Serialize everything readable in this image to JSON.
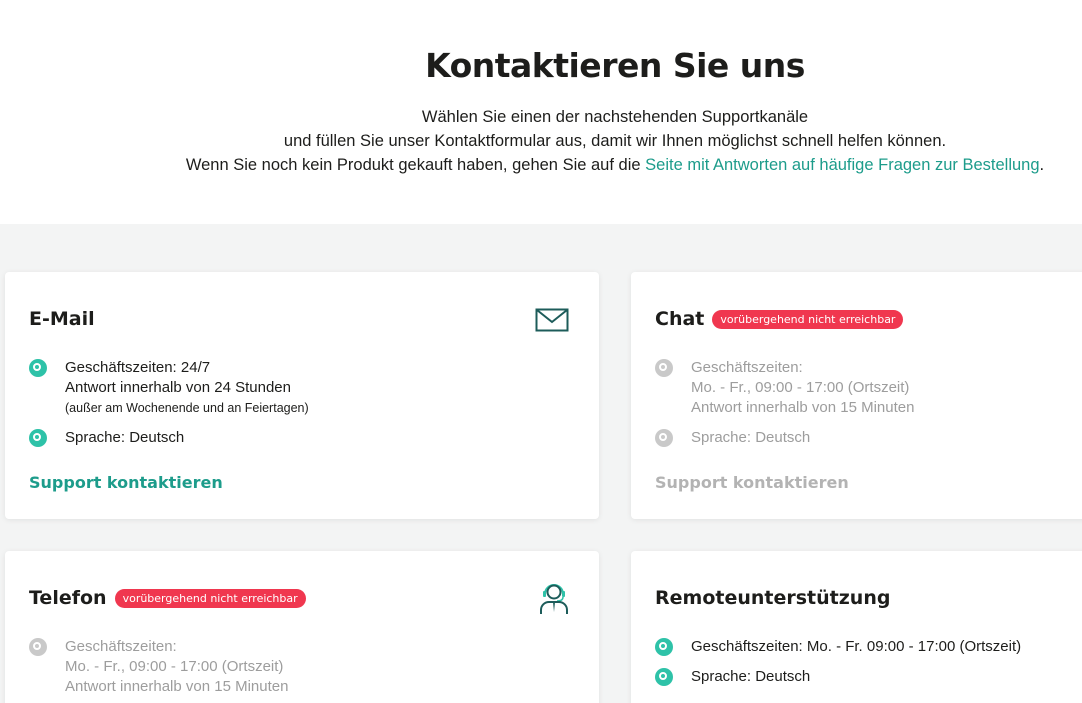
{
  "header": {
    "title": "Kontaktieren Sie uns",
    "line1": "Wählen Sie einen der nachstehenden Supportkanäle",
    "line2": "und füllen Sie unser Kontaktformular aus, damit wir Ihnen möglichst schnell helfen können.",
    "line3_prefix": "Wenn Sie noch kein Produkt gekauft haben, gehen Sie auf die ",
    "line3_link": "Seite mit Antworten auf häufige Fragen zur Bestellung",
    "line3_suffix": "."
  },
  "cards": {
    "email": {
      "title": "E-Mail",
      "icon": "envelope-icon",
      "hours_line1": "Geschäftszeiten: 24/7",
      "hours_line2": "Antwort innerhalb von 24 Stunden",
      "hours_note": "(außer am Wochenende und an Feiertagen)",
      "language": "Sprache: Deutsch",
      "cta": "Support kontaktieren"
    },
    "chat": {
      "title": "Chat",
      "badge": "vorübergehend nicht erreichbar",
      "hours_line1": "Geschäftszeiten:",
      "hours_line2": "Mo. - Fr., 09:00 - 17:00 (Ortszeit)",
      "hours_line3": "Antwort innerhalb von 15 Minuten",
      "language": "Sprache: Deutsch",
      "cta": "Support kontaktieren"
    },
    "phone": {
      "title": "Telefon",
      "badge": "vorübergehend nicht erreichbar",
      "icon": "support-agent-icon",
      "hours_line1": "Geschäftszeiten:",
      "hours_line2": "Mo. - Fr., 09:00 - 17:00 (Ortszeit)",
      "hours_line3": "Antwort innerhalb von 15 Minuten"
    },
    "remote": {
      "title": "Remoteunterstützung",
      "hours": "Geschäftszeiten: Mo. - Fr. 09:00 - 17:00 (Ortszeit)",
      "language": "Sprache: Deutsch"
    }
  },
  "colors": {
    "accent": "#1d9c8b",
    "bullet_active": "#2ec2a8",
    "bullet_disabled": "#c9c9c9",
    "badge": "#f0374f",
    "background_gray": "#f3f4f4"
  }
}
